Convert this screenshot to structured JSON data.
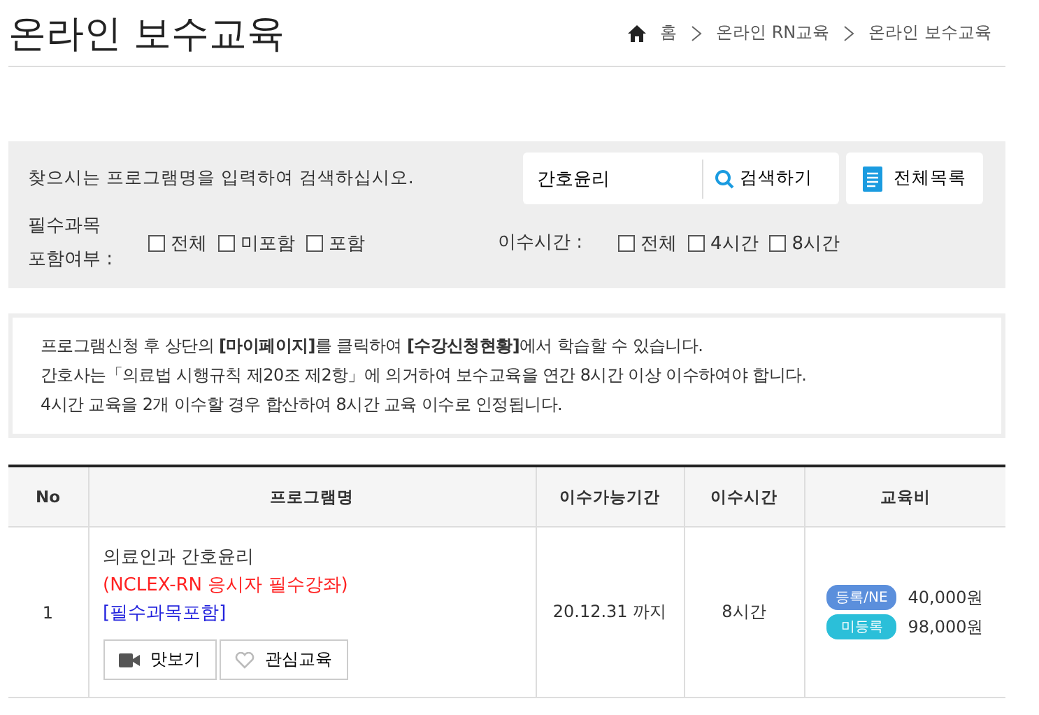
{
  "page_title": "온라인 보수교육",
  "breadcrumb": [
    "홈",
    "온라인 RN교육",
    "온라인 보수교육"
  ],
  "search": {
    "hint": "찾으시는 프로그램명을 입력하여 검색하십시오.",
    "value": "간호윤리",
    "search_button": "검색하기",
    "list_button": "전체목록"
  },
  "filters": [
    {
      "label": "필수과목\n포함여부 :",
      "options": [
        {
          "label": "전체",
          "checked": false
        },
        {
          "label": "미포함",
          "checked": false
        },
        {
          "label": "포함",
          "checked": false
        }
      ]
    },
    {
      "label": "이수시간 :",
      "options": [
        {
          "label": "전체",
          "checked": false
        },
        {
          "label": "4시간",
          "checked": false
        },
        {
          "label": "8시간",
          "checked": false
        }
      ]
    }
  ],
  "notice": [
    "프로그램신청 후 상단의 **[마이페이지]**를 클릭하여 **[수강신청현황]**에서 학습할 수 있습니다.",
    "간호사는「의료법 시행규칙 제20조 제2항」에 의거하여 보수교육을 연간 8시간 이상 이수하여야 합니다.",
    "4시간 교육을 2개 이수할 경우 합산하여 8시간 교육 이수로 인정됩니다."
  ],
  "table": {
    "columns": [
      "No",
      "프로그램명",
      "이수가능기간",
      "이수시간",
      "교육비"
    ],
    "rows": [
      {
        "no": "1",
        "title": "의료인과 간호윤리",
        "note": "(NCLEX-RN 응시자 필수강좌)",
        "tag": "[필수과목포함]",
        "buttons": [
          {
            "kind": "preview",
            "label": "맛보기"
          },
          {
            "kind": "favorite",
            "label": "관심교육"
          }
        ],
        "period": "20.12.31 까지",
        "hours": "8시간",
        "fees": [
          {
            "badge": "등록/NE",
            "color": "#5b8fdc",
            "price": "40,000원"
          },
          {
            "badge": "미등록",
            "color": "#2bbfd9",
            "price": "98,000원"
          }
        ]
      }
    ]
  }
}
